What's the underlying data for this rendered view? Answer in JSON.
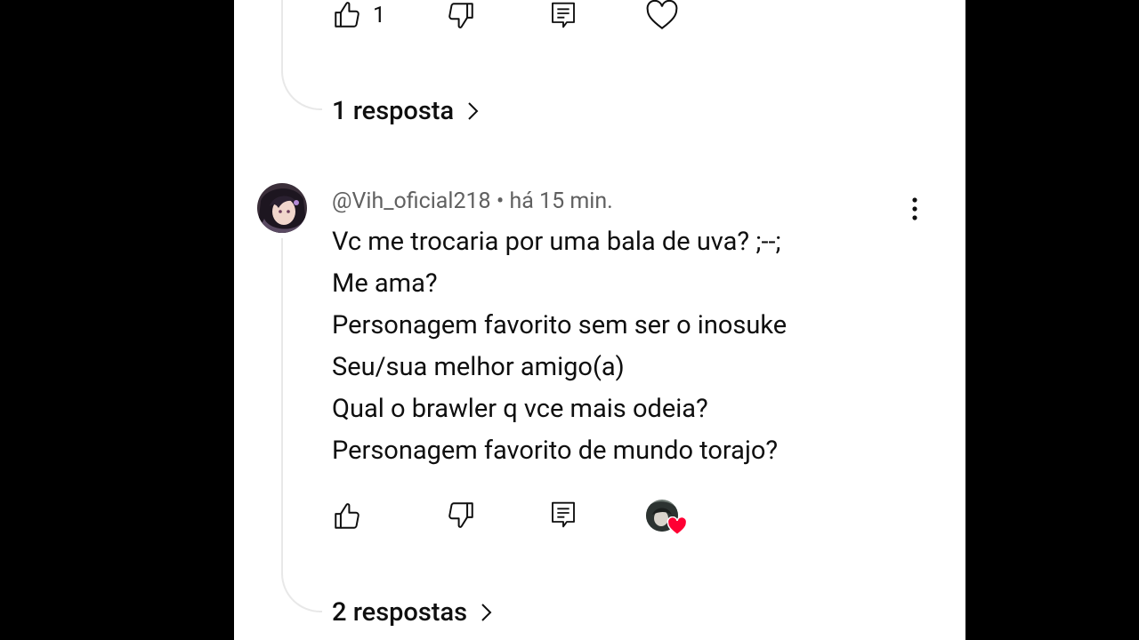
{
  "prev_comment": {
    "like_count": "1",
    "replies_label": "1 resposta"
  },
  "comment": {
    "author": "@Vih_oficial218",
    "separator": "•",
    "time": "há 15 min.",
    "lines": [
      "Vc me trocaria por uma bala de uva? ;--;",
      "Me ama?",
      "Personagem favorito sem ser o inosuke",
      "Seu/sua melhor amigo(a)",
      "Qual o brawler q vce mais odeia?",
      "Personagem favorito de mundo torajo?"
    ],
    "replies_label": "2 respostas"
  },
  "icons": {
    "like": "thumbs-up-icon",
    "dislike": "thumbs-down-icon",
    "reply": "reply-comment-icon",
    "heart": "heart-icon",
    "more": "more-vert-icon",
    "chevron": "chevron-right-icon"
  },
  "colors": {
    "background_side": "#000000",
    "panel": "#ffffff",
    "text": "#0f0f0f",
    "meta_text": "#606060",
    "heart_red": "#ff0033",
    "thread_line": "#e8e8e8"
  }
}
